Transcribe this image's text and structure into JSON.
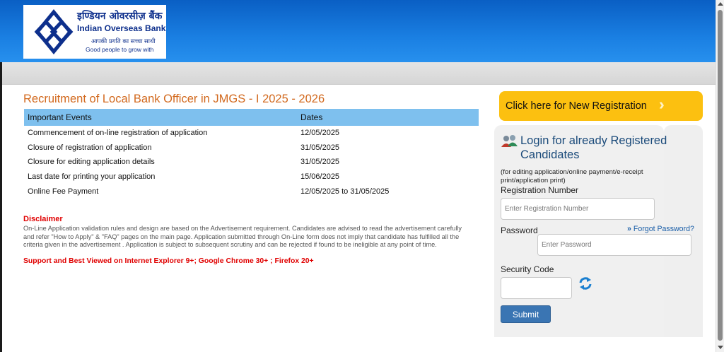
{
  "header": {
    "logo": {
      "hindi_name": "इण्डियन ओवरसीज़ बैंक",
      "english_name": "Indian Overseas Bank",
      "tagline_hindi": "आपकी प्रगति का सच्चा साथी",
      "tagline_english": "Good people to grow with"
    }
  },
  "main": {
    "title": "Recruitment of Local Bank Officer in JMGS - I 2025 - 2026",
    "table": {
      "columns": [
        "Important Events",
        "Dates"
      ],
      "rows": [
        {
          "event": "Commencement of on-line registration of application",
          "date": "12/05/2025"
        },
        {
          "event": "Closure of registration of application",
          "date": "31/05/2025"
        },
        {
          "event": "Closure for editing application details",
          "date": "31/05/2025"
        },
        {
          "event": "Last date for printing your application",
          "date": "15/06/2025"
        },
        {
          "event": "Online Fee Payment",
          "date": "12/05/2025 to 31/05/2025"
        }
      ]
    },
    "disclaimer": {
      "title": "Disclaimer",
      "text": "On-Line Application validation rules and design are based on the Advertisement requirement. Candidates are advised to read the advertisement carefully and refer \"How to Apply\" & \"FAQ\" pages on the main page. Application submitted through On-Line form does not imply that candidate has fulfilled all the criteria given in the advertisement . Application is subject to subsequent scrutiny and can be rejected if found to be ineligible at any point of time."
    },
    "support_note": "Support and Best Viewed on Internet Explorer 9+; Google Chrome 30+ ; Firefox 20+"
  },
  "sidebar": {
    "new_registration_label": "Click here for New Registration",
    "login": {
      "title": "Login for already Registered Candidates",
      "subtitle": "(for editing application/online payment/e-receipt print/application print)",
      "registration_label": "Registration Number",
      "registration_placeholder": "Enter Registration Number",
      "password_label": "Password",
      "forgot_label": "Forgot Password?",
      "password_placeholder": "Enter Password",
      "security_label": "Security Code",
      "security_value": "",
      "submit_label": "Submit"
    }
  },
  "colors": {
    "header_blue": "#1a7fe2",
    "title_orange": "#d2691e",
    "table_header": "#7ec0ee",
    "registration_yellow": "#fcc010",
    "disclaimer_red": "#e00000",
    "submit_blue": "#3a75b3"
  },
  "icons": [
    "bank-logo-icon",
    "login-users-icon",
    "double-chevron-icon",
    "refresh-captcha-icon"
  ]
}
